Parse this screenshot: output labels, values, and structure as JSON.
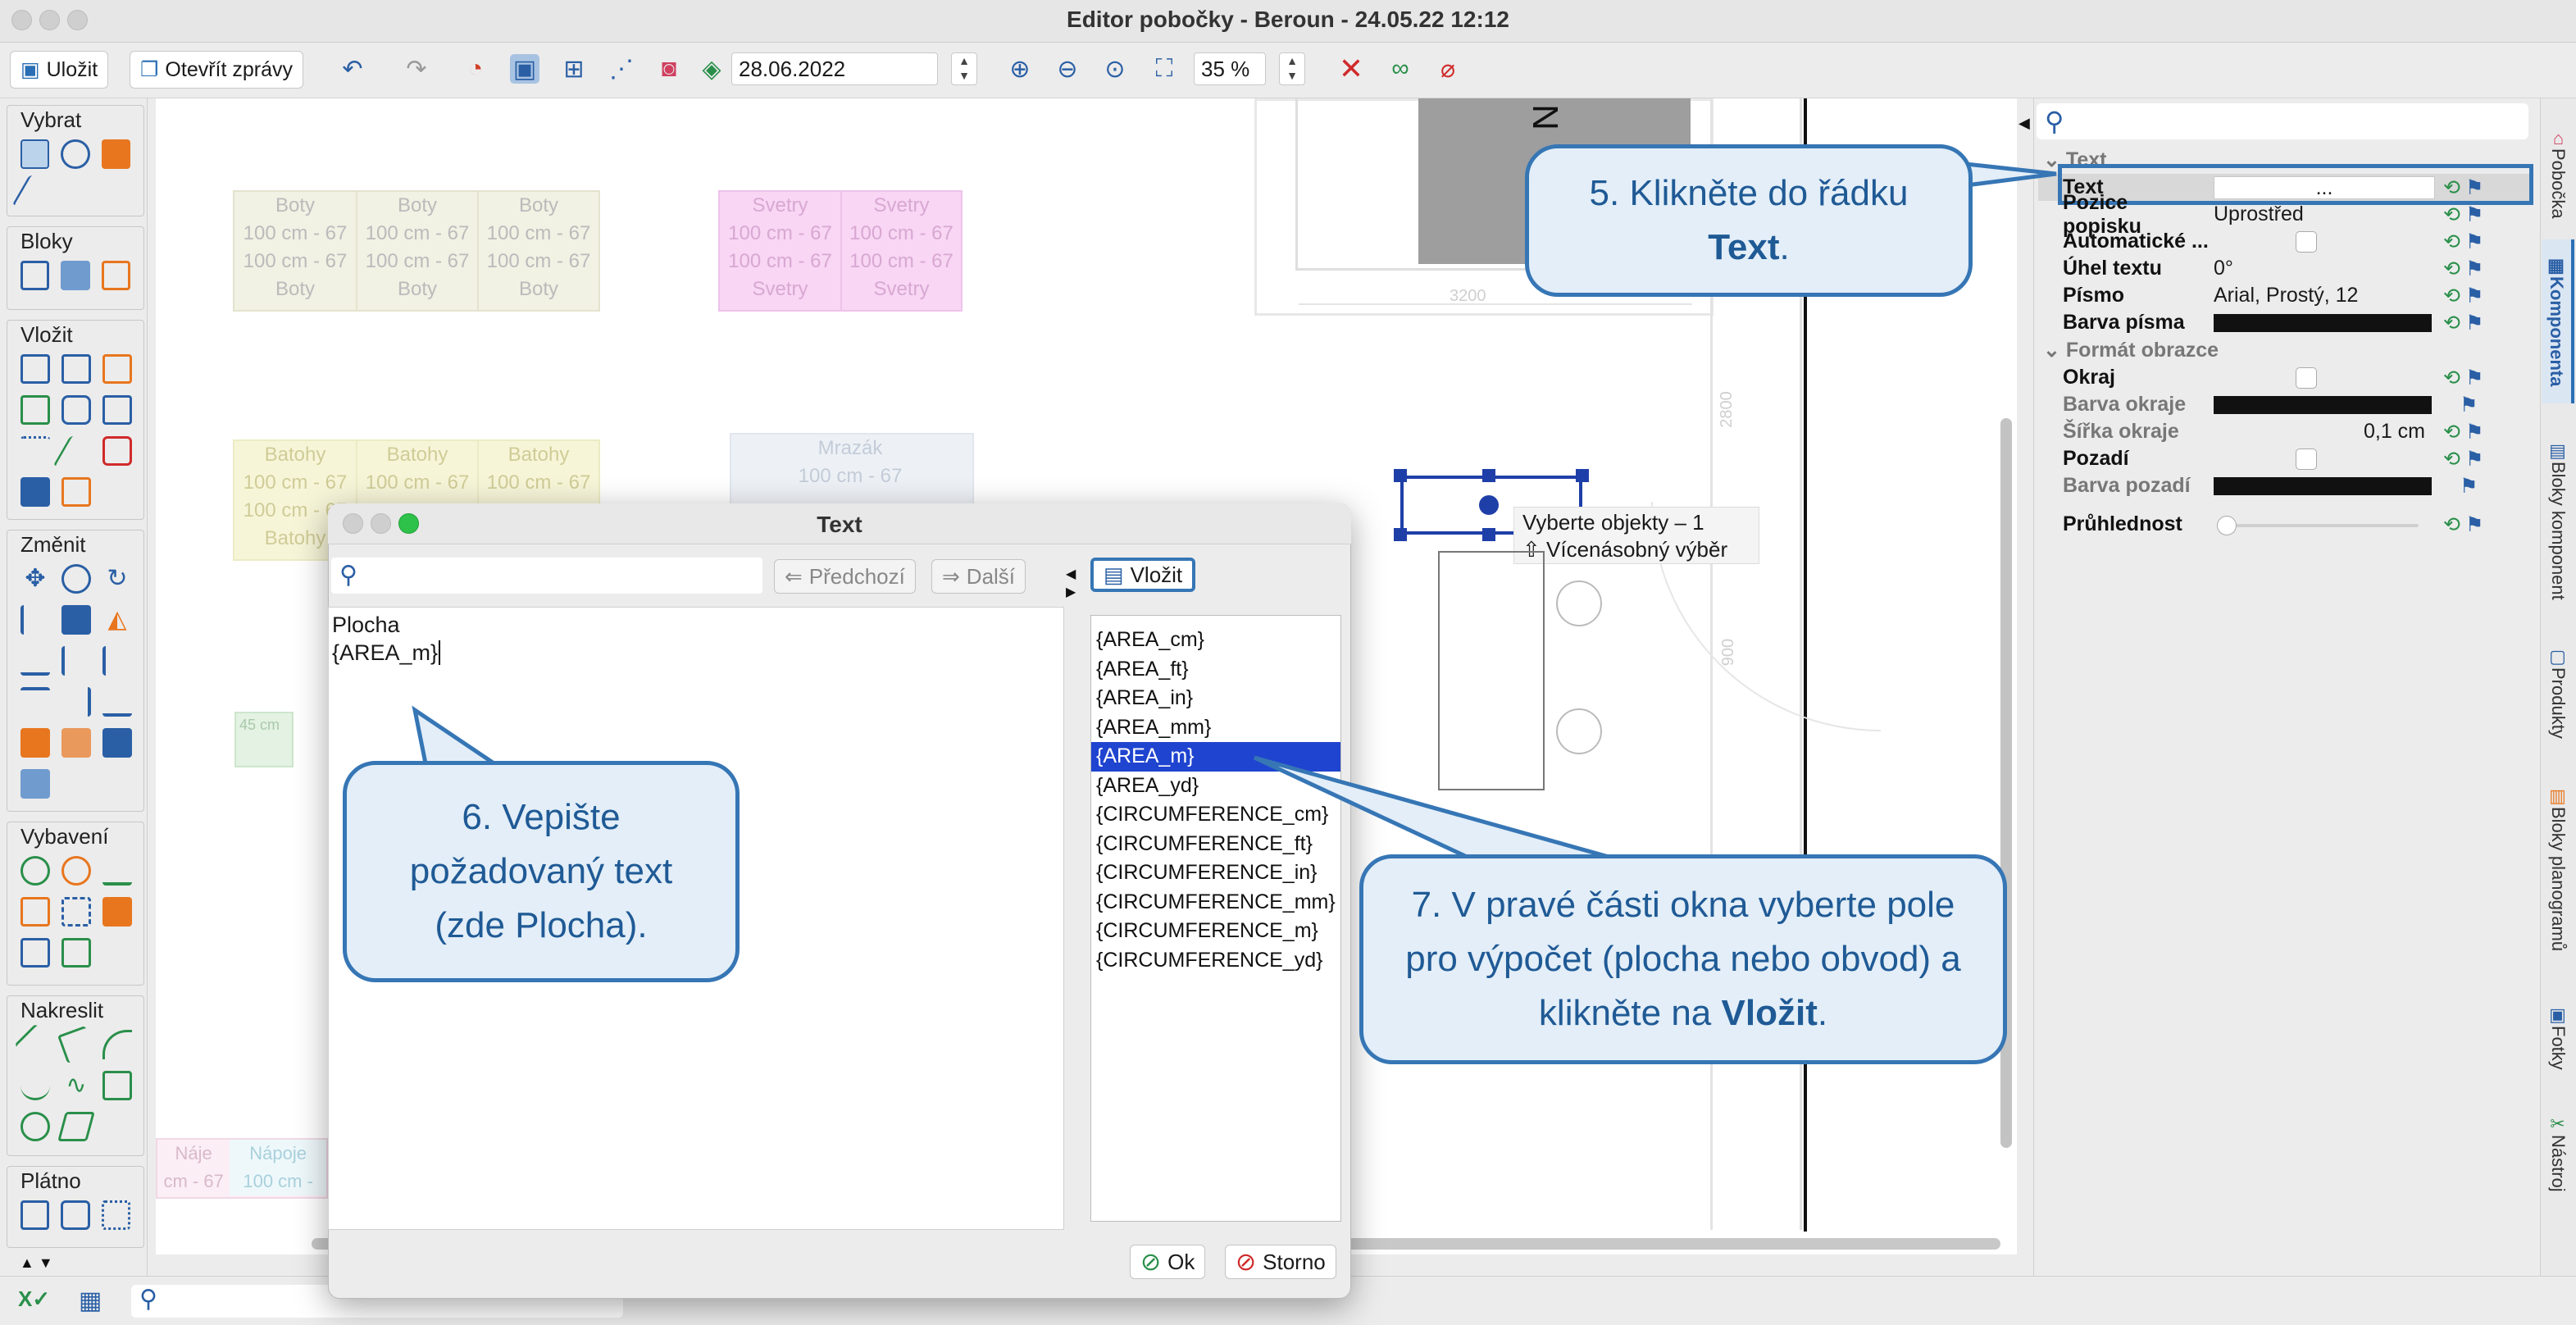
{
  "window": {
    "title": "Editor pobočky - Beroun - 24.05.22 12:12"
  },
  "toolbar": {
    "save": "Uložit",
    "open_reports": "Otevřít zprávy",
    "date": "28.06.2022",
    "zoom": "35 %"
  },
  "palette": {
    "groups": [
      "Vybrat",
      "Bloky",
      "Vložit",
      "Změnit",
      "Vybavení",
      "Nakreslit",
      "Plátno"
    ]
  },
  "canvas": {
    "blocks": {
      "boty": [
        "Boty",
        "100 cm - 67",
        "100 cm - 67",
        "Boty"
      ],
      "svetry": [
        "Svetry",
        "100 cm - 67",
        "100 cm - 67",
        "Svetry"
      ],
      "batohy": [
        "Batohy",
        "100 cm - 67",
        "100 cm - 67",
        "Batohy"
      ],
      "mrazak": [
        "Mrazák",
        "100 cm - 67",
        "Mraz",
        "Mrazák"
      ],
      "small": "45 cm",
      "bottom_left": [
        "Náje",
        "cm - 67",
        "Nápoje",
        "100 cm -"
      ],
      "dimension_3200": "3200",
      "dimension_2800": "2800",
      "dimension_900": "900",
      "top_letter": "N"
    },
    "tooltip": {
      "line1": "Vyberte objekty – 1",
      "line2": "⇧ Vícenásobný výběr"
    }
  },
  "properties": {
    "search_placeholder": "",
    "section_text": "Text",
    "section_format": "Formát obrazce",
    "rows": [
      {
        "label": "Text",
        "value": "..."
      },
      {
        "label": "Pozice popisku",
        "value": "Uprostřed"
      },
      {
        "label": "Automatické ...",
        "value": ""
      },
      {
        "label": "Úhel textu",
        "value": "0°"
      },
      {
        "label": "Písmo",
        "value": "Arial, Prostý, 12"
      },
      {
        "label": "Barva písma",
        "value": ""
      },
      {
        "label": "Okraj",
        "value": ""
      },
      {
        "label": "Barva okraje",
        "value": ""
      },
      {
        "label": "Šířka okraje",
        "value": "0,1 cm"
      },
      {
        "label": "Pozadí",
        "value": ""
      },
      {
        "label": "Barva pozadí",
        "value": ""
      },
      {
        "label": "Průhlednost",
        "value": ""
      }
    ]
  },
  "sidetabs": [
    "Pobočka",
    "Komponenta",
    "Bloky komponent",
    "Produkty",
    "Bloky planogramů",
    "Fotky",
    "Nástroj"
  ],
  "dialog": {
    "title": "Text",
    "prev": "Předchozí",
    "next": "Další",
    "insert": "Vložit",
    "content_line1": "Plocha",
    "content_line2": "{AREA_m}",
    "ok": "Ok",
    "cancel": "Storno",
    "fields": [
      "{AREA_cm}",
      "{AREA_ft}",
      "{AREA_in}",
      "{AREA_mm}",
      "{AREA_m}",
      "{AREA_yd}",
      "{CIRCUMFERENCE_cm}",
      "{CIRCUMFERENCE_ft}",
      "{CIRCUMFERENCE_in}",
      "{CIRCUMFERENCE_mm}",
      "{CIRCUMFERENCE_m}",
      "{CIRCUMFERENCE_yd}"
    ],
    "selected_index": 4
  },
  "callouts": {
    "c5_a": "5. Klikněte do řádku",
    "c5_b": "Text",
    "c5_c": ".",
    "c6": "6. Vepište požadovaný text (zde Plocha).",
    "c7_a": "7. V pravé části okna vyberte pole pro výpočet (plocha nebo obvod) a klikněte na",
    "c7_b": "Vložit",
    "c7_c": "."
  },
  "colors": {
    "accent": "#3676b5",
    "selection": "#1f44cf",
    "callout_bg": "#e3eef8"
  }
}
